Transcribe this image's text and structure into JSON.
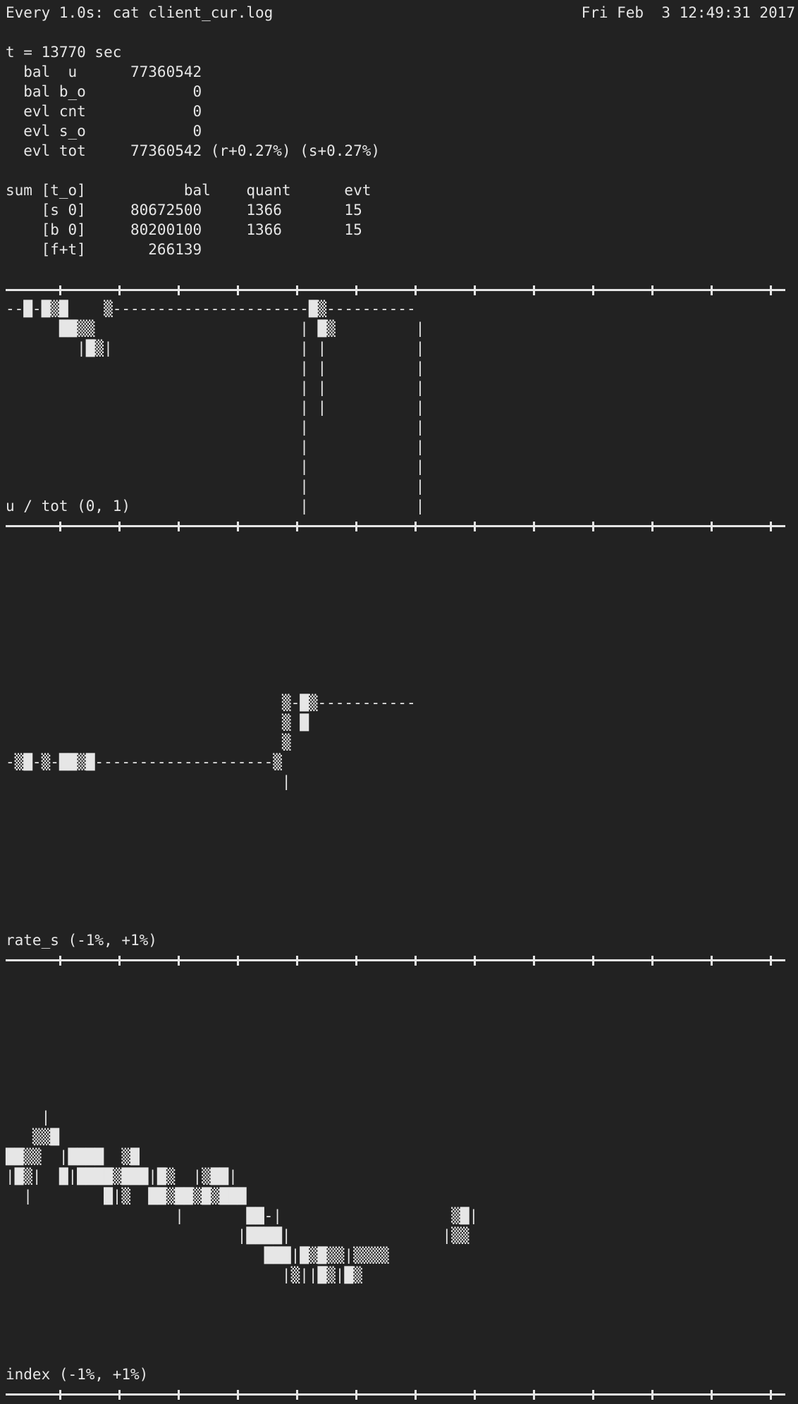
{
  "header": {
    "command": "Every 1.0s: cat client_cur.log",
    "datetime": "Fri Feb  3 12:49:31 2017"
  },
  "status": {
    "time_line": "t = 13770 sec",
    "lines": [
      "  bal  u      77360542",
      "  bal b_o            0",
      "  evl cnt            0",
      "  evl s_o            0",
      "  evl tot     77360542 (r+0.27%) (s+0.27%)"
    ]
  },
  "summary": {
    "header_line": "sum [t_o]           bal    quant      evt",
    "rows": [
      "    [s 0]     80672500     1366       15",
      "    [b 0]     80200100     1366       15",
      "    [f+t]       266139"
    ]
  },
  "panels": [
    {
      "label": "u / tot (0, 1)",
      "art": "--█-█▒█    ▒----------------------█▒----------\n      ██▒▒                       | █▒         |\n        |█▒|                     | |          |\n                                 | |          |\n                                 | |          |\n                                 | |          |\n                                 |            |\n                                 |            |\n                                 |            |\n                                 |            |\n                                 |            |"
    },
    {
      "label": "rate_s (-1%, +1%)",
      "art": "\n\n\n\n\n\n\n\n                               ▒-█▒-----------\n                               ▒ █\n                               ▒\n-▒█-▒-██▒█--------------------▒\n                               |"
    },
    {
      "label": "index (-1%, +1%)",
      "art": "\n\n\n\n\n\n\n    |\n   ▒▒█\n██▒▒  |████  ▒█\n|█▒|  █|████▒███|█▒  |▒██|\n  |        █|▒  ██▒██▒█▒███\n                   |       ██-|                   ▒█|\n                          |████|                 |▒▒\n                             ███|█▒█▒▒|▒▒▒▒\n                               |▒||█▒|█▒"
    }
  ],
  "ruler_ticks": 13
}
